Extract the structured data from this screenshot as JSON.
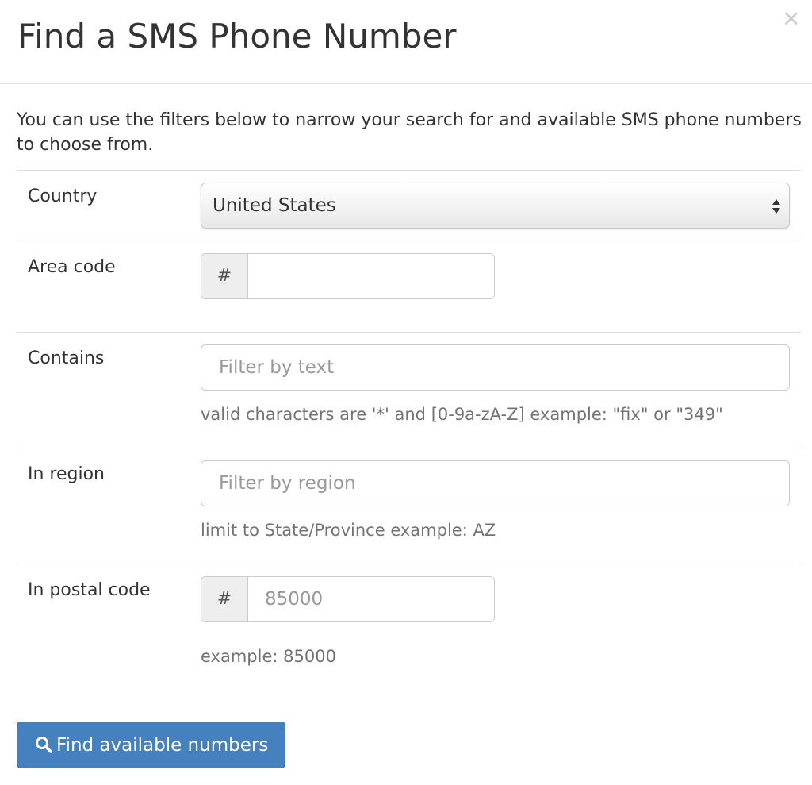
{
  "header": {
    "title": "Find a SMS Phone Number",
    "close_glyph": "×"
  },
  "intro": "You can use the filters below to narrow your search for and available SMS phone numbers to choose from.",
  "form": {
    "country": {
      "label": "Country",
      "selected": "United States"
    },
    "area_code": {
      "label": "Area code",
      "addon": "#",
      "value": "",
      "placeholder": ""
    },
    "contains": {
      "label": "Contains",
      "placeholder": "Filter by text",
      "help": "valid characters are '*' and [0-9a-zA-Z] example: \"fix\" or \"349\""
    },
    "region": {
      "label": "In region",
      "placeholder": "Filter by region",
      "help": "limit to State/Province example: AZ"
    },
    "postal_code": {
      "label": "In postal code",
      "addon": "#",
      "placeholder": "85000",
      "help": "example: 85000"
    }
  },
  "submit": {
    "label": "Find available numbers",
    "icon": "search-icon"
  },
  "colors": {
    "primary": "#4580bf",
    "primary_border": "#2e6da4",
    "help_text": "#737373",
    "divider": "#dddddd"
  }
}
